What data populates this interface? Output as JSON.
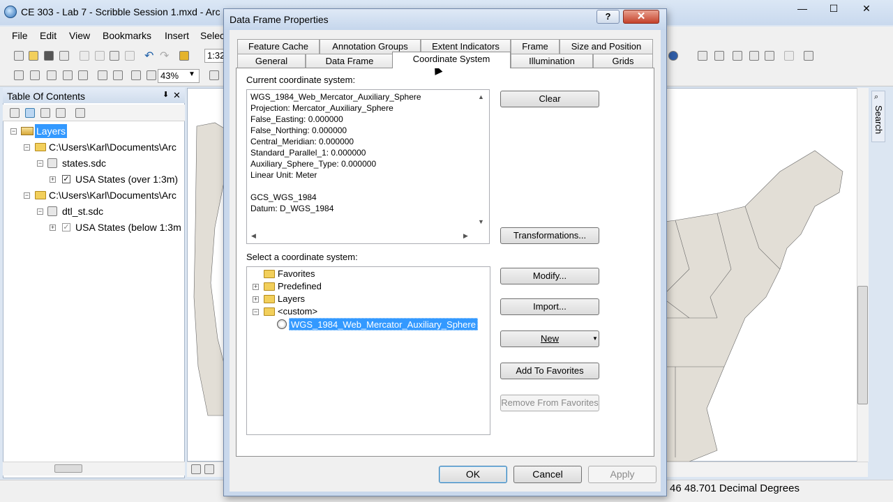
{
  "main_window": {
    "title": "CE 303 - Lab 7 - Scribble Session 1.mxd - Arc",
    "menus": [
      "File",
      "Edit",
      "View",
      "Bookmarks",
      "Insert",
      "Selec"
    ],
    "scale_value": "1:32",
    "zoom_value": "43%",
    "min_glyph": "—",
    "max_glyph": "☐",
    "close_glyph": "✕"
  },
  "toc": {
    "title": "Table Of Contents",
    "pin_glyph": "⬇",
    "close_glyph": "✕",
    "items": [
      {
        "label": "Layers"
      },
      {
        "label": "C:\\Users\\Karl\\Documents\\Arc"
      },
      {
        "label": "states.sdc"
      },
      {
        "label": "USA States (over 1:3m)"
      },
      {
        "label": "C:\\Users\\Karl\\Documents\\Arc"
      },
      {
        "label": "dtl_st.sdc"
      },
      {
        "label": "USA States (below 1:3m"
      }
    ]
  },
  "map": {
    "search_tab": "Search",
    "status_coords": "46  48.701 Decimal Degrees"
  },
  "dialog": {
    "title": "Data Frame Properties",
    "help_glyph": "?",
    "close_glyph": "✕",
    "tabs_row1": [
      "Feature Cache",
      "Annotation Groups",
      "Extent Indicators",
      "Frame",
      "Size and Position"
    ],
    "tabs_row2": [
      "General",
      "Data Frame",
      "Coordinate System",
      "Illumination",
      "Grids"
    ],
    "current_label": "Current coordinate system:",
    "current_lines": [
      "WGS_1984_Web_Mercator_Auxiliary_Sphere",
      "Projection: Mercator_Auxiliary_Sphere",
      "False_Easting: 0.000000",
      "False_Northing: 0.000000",
      "Central_Meridian: 0.000000",
      "Standard_Parallel_1: 0.000000",
      "Auxiliary_Sphere_Type: 0.000000",
      "Linear Unit: Meter",
      "",
      "GCS_WGS_1984",
      "Datum: D_WGS_1984"
    ],
    "select_label": "Select a coordinate system:",
    "tree": [
      {
        "label": "Favorites"
      },
      {
        "label": "Predefined"
      },
      {
        "label": "Layers"
      },
      {
        "label": "<custom>"
      },
      {
        "label": "WGS_1984_Web_Mercator_Auxiliary_Sphere"
      }
    ],
    "buttons": {
      "clear": "Clear",
      "transformations": "Transformations...",
      "modify": "Modify...",
      "import": "Import...",
      "new": "New",
      "add_favorites": "Add To Favorites",
      "remove_favorites": "Remove From Favorites",
      "ok": "OK",
      "cancel": "Cancel",
      "apply": "Apply"
    }
  }
}
